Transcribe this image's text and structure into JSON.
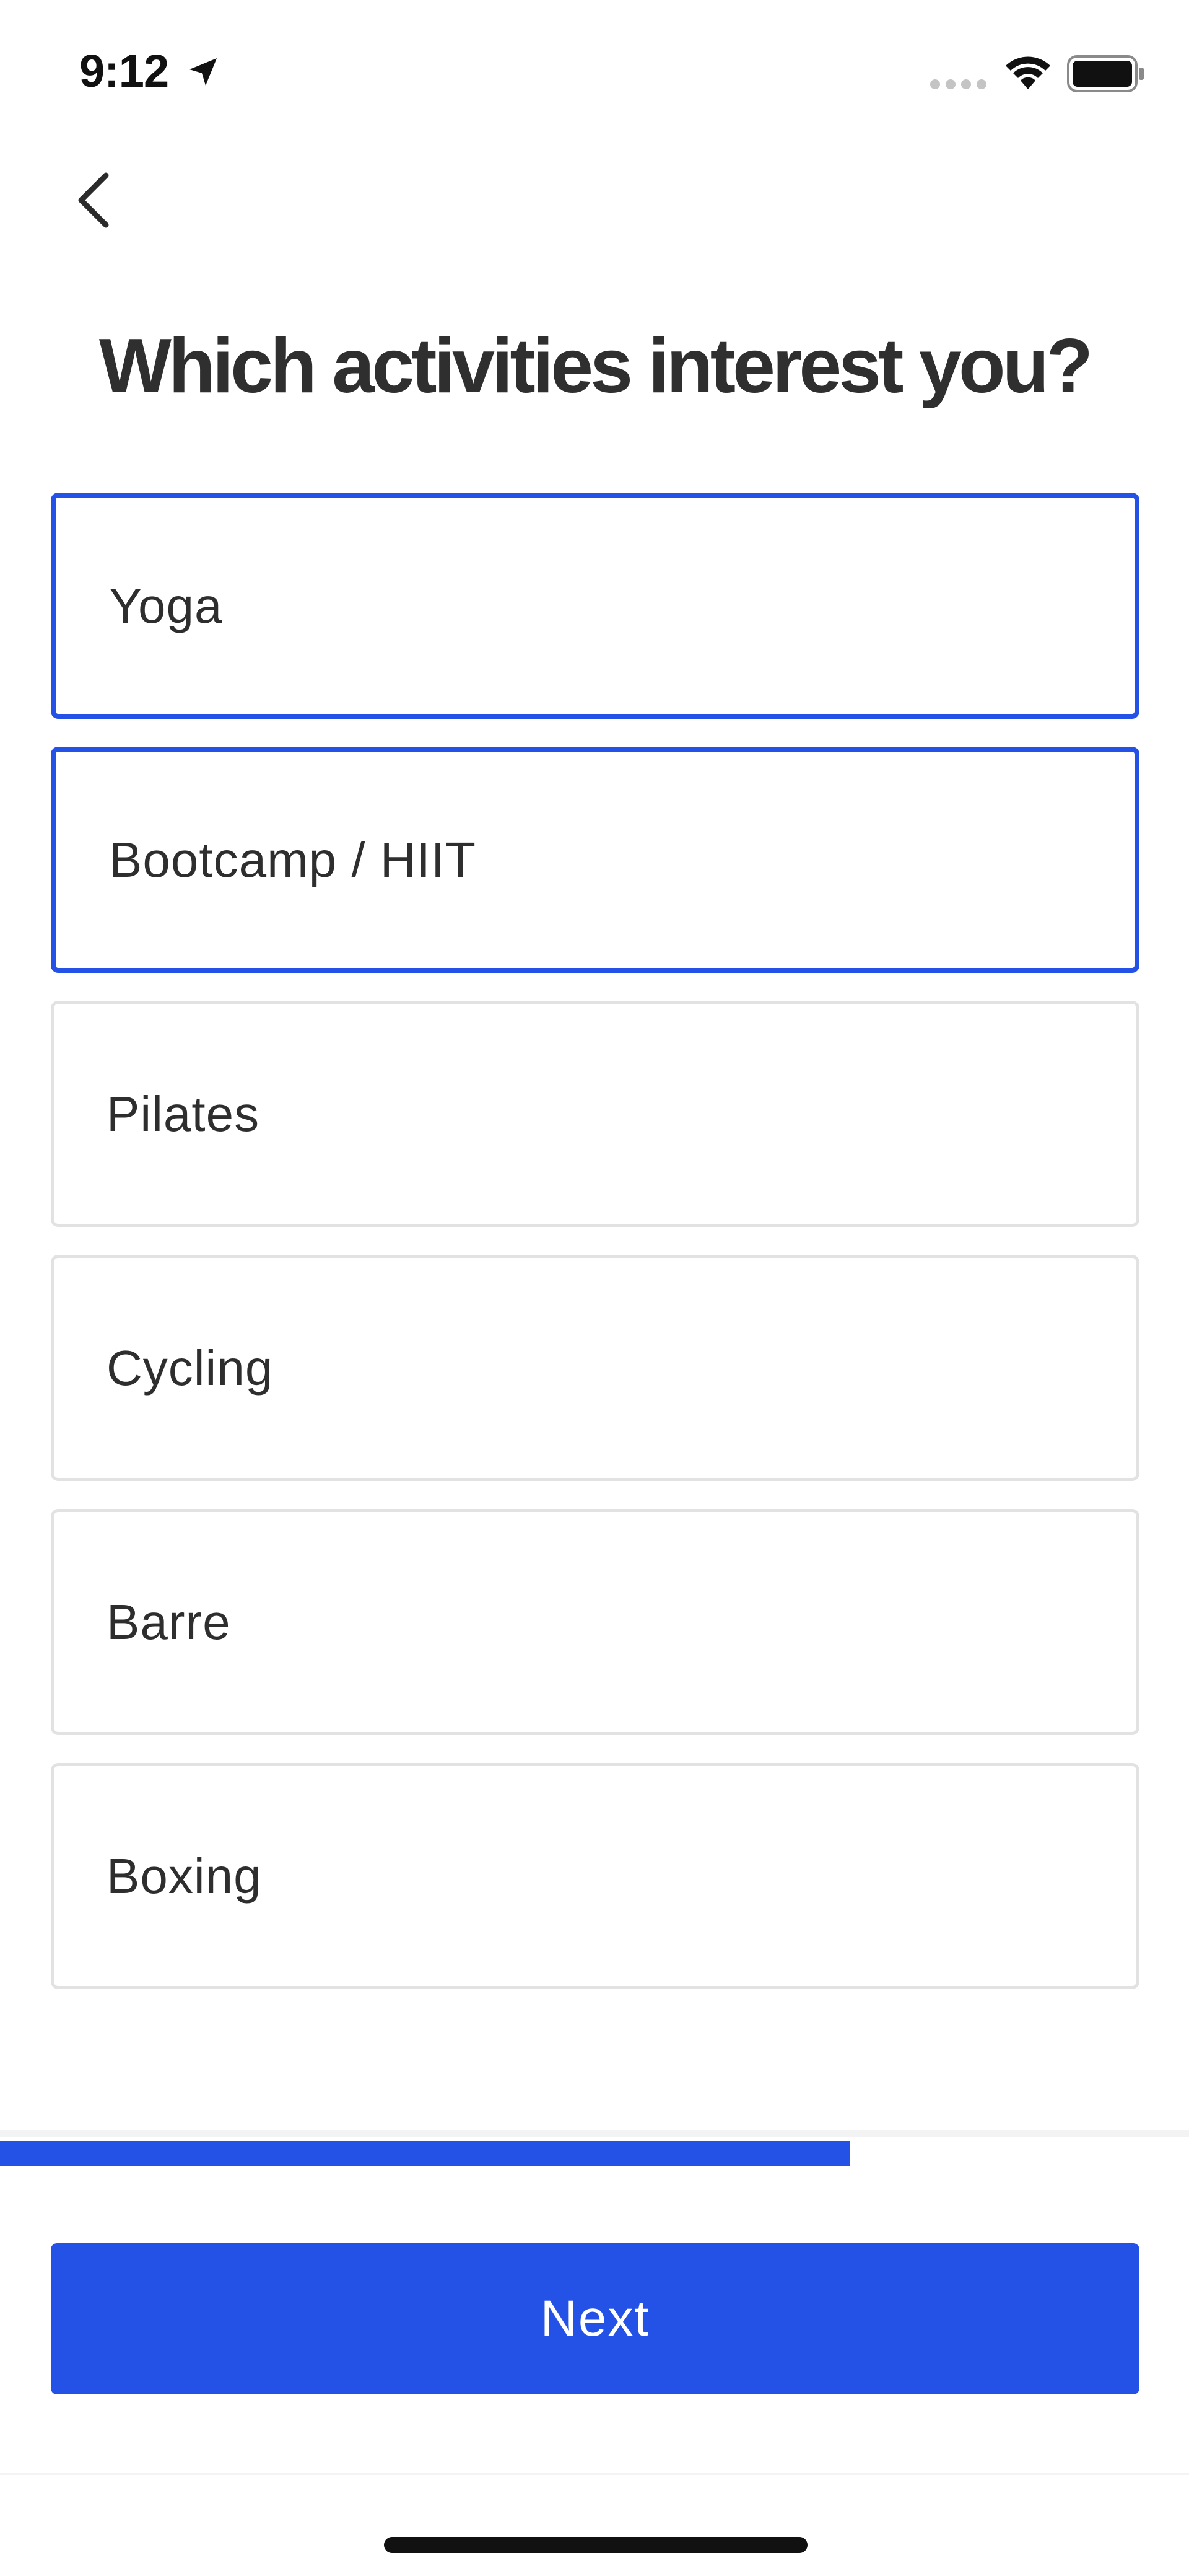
{
  "status_bar": {
    "time": "9:12",
    "icons": [
      "location-arrow-icon",
      "signal-icon",
      "wifi-icon",
      "battery-icon"
    ]
  },
  "navigation": {
    "back_icon": "chevron-left-icon"
  },
  "title": "Which activities interest you?",
  "options": [
    {
      "label": "Yoga",
      "selected": true
    },
    {
      "label": "Bootcamp / HIIT",
      "selected": true
    },
    {
      "label": "Pilates",
      "selected": false
    },
    {
      "label": "Cycling",
      "selected": false
    },
    {
      "label": "Barre",
      "selected": false
    },
    {
      "label": "Boxing",
      "selected": false
    }
  ],
  "progress": {
    "fraction": 0.715
  },
  "next_button": {
    "label": "Next"
  },
  "colors": {
    "accent": "#2552e6",
    "border": "#e2e2e2",
    "text": "#2e2e2e"
  }
}
